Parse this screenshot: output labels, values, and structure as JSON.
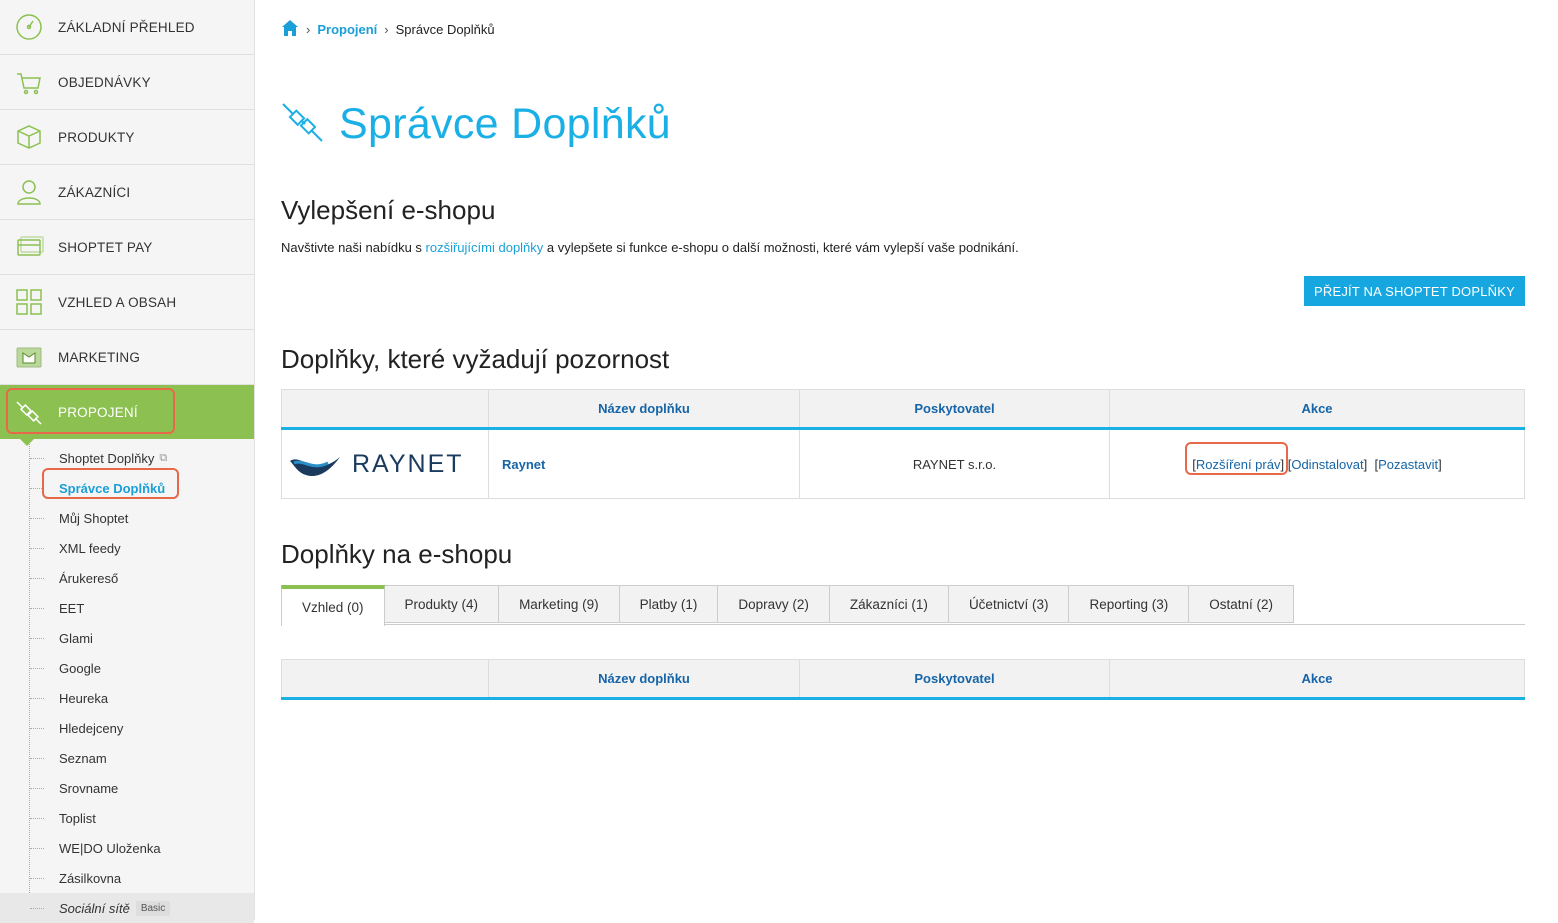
{
  "sidebar": {
    "items": [
      {
        "label": "ZÁKLADNÍ PŘEHLED",
        "icon": "dashboard-icon"
      },
      {
        "label": "OBJEDNÁVKY",
        "icon": "cart-icon"
      },
      {
        "label": "PRODUKTY",
        "icon": "box-icon"
      },
      {
        "label": "ZÁKAZNÍCI",
        "icon": "user-icon"
      },
      {
        "label": "SHOPTET PAY",
        "icon": "card-icon"
      },
      {
        "label": "VZHLED A OBSAH",
        "icon": "layout-icon"
      },
      {
        "label": "MARKETING",
        "icon": "marketing-icon"
      },
      {
        "label": "PROPOJENÍ",
        "icon": "plug-icon"
      }
    ],
    "sub_items": [
      {
        "label": "Shoptet Doplňky"
      },
      {
        "label": "Správce Doplňků"
      },
      {
        "label": "Můj Shoptet"
      },
      {
        "label": "XML feedy"
      },
      {
        "label": "Árukereső"
      },
      {
        "label": "EET"
      },
      {
        "label": "Glami"
      },
      {
        "label": "Google"
      },
      {
        "label": "Heureka"
      },
      {
        "label": "Hledejceny"
      },
      {
        "label": "Seznam"
      },
      {
        "label": "Srovname"
      },
      {
        "label": "Toplist"
      },
      {
        "label": "WE|DO Uloženka"
      },
      {
        "label": "Zásilkovna"
      },
      {
        "label": "Sociální sítě",
        "badge": "Basic"
      }
    ]
  },
  "breadcrumb": {
    "link": "Propojení",
    "current": "Správce Doplňků"
  },
  "page_title": "Správce Doplňků",
  "upgrade": {
    "heading": "Vylepšení e-shopu",
    "text_before": "Navštivte naši nabídku s ",
    "link": "rozšiřujícími doplňky",
    "text_after": " a vylepšete si funkce e-shopu o další možnosti, které vám vylepší vaše podnikání.",
    "cta": "PŘEJÍT NA SHOPTET DOPLŇKY"
  },
  "attention": {
    "heading": "Doplňky, které vyžadují pozornost",
    "columns": [
      "",
      "Název doplňku",
      "Poskytovatel",
      "Akce"
    ],
    "rows": [
      {
        "logo": "RAYNET",
        "name": "Raynet",
        "provider": "RAYNET s.r.o.",
        "actions": [
          "Rozšíření práv",
          "Odinstalovat",
          "Pozastavit"
        ]
      }
    ]
  },
  "installed": {
    "heading": "Doplňky na e-shopu",
    "tabs": [
      "Vzhled (0)",
      "Produkty (4)",
      "Marketing (9)",
      "Platby (1)",
      "Dopravy (2)",
      "Zákazníci (1)",
      "Účetnictví (3)",
      "Reporting (3)",
      "Ostatní (2)"
    ],
    "columns": [
      "",
      "Název doplňku",
      "Poskytovatel",
      "Akce"
    ]
  },
  "colors": {
    "accent": "#1ab0e6",
    "active_nav": "#8cc152",
    "highlight": "#e8684a"
  }
}
